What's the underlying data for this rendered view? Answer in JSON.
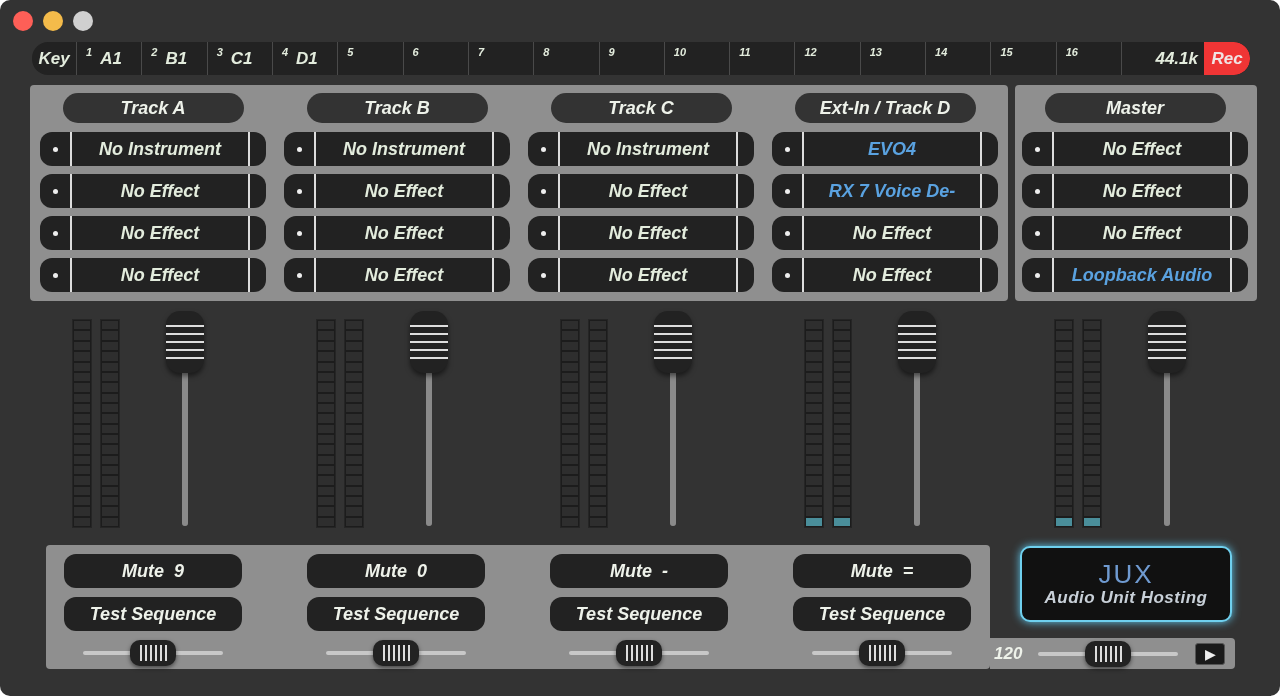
{
  "key_bar": {
    "key_label": "Key",
    "slots": [
      {
        "number": "1",
        "note": "A1"
      },
      {
        "number": "2",
        "note": "B1"
      },
      {
        "number": "3",
        "note": "C1"
      },
      {
        "number": "4",
        "note": "D1"
      },
      {
        "number": "5"
      },
      {
        "number": "6"
      },
      {
        "number": "7"
      },
      {
        "number": "8"
      },
      {
        "number": "9"
      },
      {
        "number": "10"
      },
      {
        "number": "11"
      },
      {
        "number": "12"
      },
      {
        "number": "13"
      },
      {
        "number": "14"
      },
      {
        "number": "15"
      },
      {
        "number": "16"
      }
    ],
    "sample_rate": "44.1k",
    "record_button": "Rec"
  },
  "tracks": [
    {
      "name": "Track A",
      "slots": [
        {
          "label": "No Instrument",
          "loaded": false
        },
        {
          "label": "No Effect",
          "loaded": false
        },
        {
          "label": "No Effect",
          "loaded": false
        },
        {
          "label": "No Effect",
          "loaded": false
        }
      ],
      "meters": [
        {
          "level": 0
        },
        {
          "level": 0
        }
      ],
      "fader": {
        "level": 1
      },
      "mute_button": "Mute  9",
      "test_button": "Test Sequence",
      "pan": {
        "level": 0.5
      }
    },
    {
      "name": "Track B",
      "slots": [
        {
          "label": "No Instrument",
          "loaded": false
        },
        {
          "label": "No Effect",
          "loaded": false
        },
        {
          "label": "No Effect",
          "loaded": false
        },
        {
          "label": "No Effect",
          "loaded": false
        }
      ],
      "meters": [
        {
          "level": 0
        },
        {
          "level": 0
        }
      ],
      "fader": {
        "level": 1
      },
      "mute_button": "Mute  0",
      "test_button": "Test Sequence",
      "pan": {
        "level": 0.5
      }
    },
    {
      "name": "Track C",
      "slots": [
        {
          "label": "No Instrument",
          "loaded": false
        },
        {
          "label": "No Effect",
          "loaded": false
        },
        {
          "label": "No Effect",
          "loaded": false
        },
        {
          "label": "No Effect",
          "loaded": false
        }
      ],
      "meters": [
        {
          "level": 0
        },
        {
          "level": 0
        }
      ],
      "fader": {
        "level": 1
      },
      "mute_button": "Mute  -",
      "test_button": "Test Sequence",
      "pan": {
        "level": 0.5
      }
    },
    {
      "name": "Ext-In / Track D",
      "slots": [
        {
          "label": "EVO4",
          "loaded": true
        },
        {
          "label": "RX 7 Voice De-",
          "loaded": true
        },
        {
          "label": "No Effect",
          "loaded": false
        },
        {
          "label": "No Effect",
          "loaded": false
        }
      ],
      "meters": [
        {
          "level": 0.05
        },
        {
          "level": 0.05
        }
      ],
      "fader": {
        "level": 1
      },
      "mute_button": "Mute  =",
      "test_button": "Test Sequence",
      "pan": {
        "level": 0.5
      }
    }
  ],
  "master": {
    "name": "Master",
    "slots": [
      {
        "label": "No Effect",
        "loaded": false
      },
      {
        "label": "No Effect",
        "loaded": false
      },
      {
        "label": "No Effect",
        "loaded": false
      },
      {
        "label": "Loopback Audio",
        "loaded": true
      }
    ],
    "meters": [
      {
        "level": 0.05
      },
      {
        "level": 0.05
      }
    ],
    "fader": {
      "level": 1
    }
  },
  "logo": {
    "mark": "JUX",
    "caption": "Audio Unit Hosting"
  },
  "transport": {
    "tempo": "120",
    "tempo_slider": {
      "level": 0.5
    },
    "play_button": "▶"
  }
}
